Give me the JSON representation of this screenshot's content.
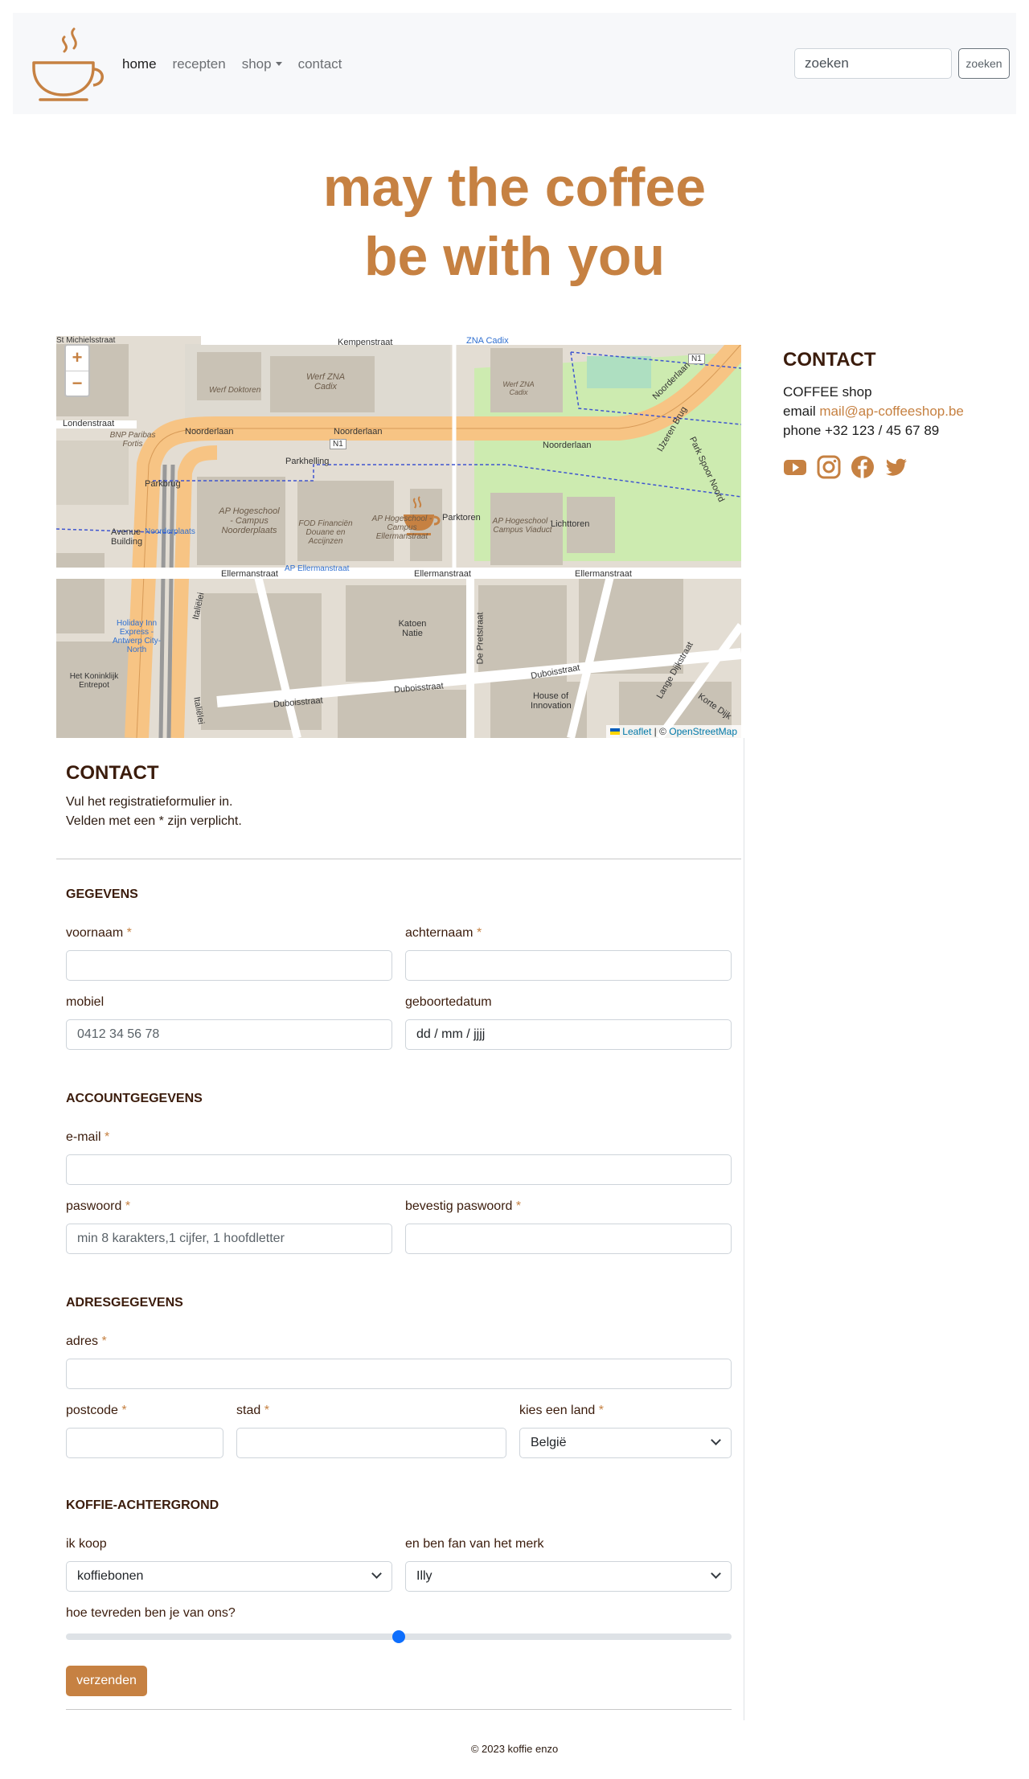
{
  "nav": {
    "links": [
      {
        "label": "home",
        "active": true
      },
      {
        "label": "recepten",
        "active": false
      },
      {
        "label": "shop",
        "active": false,
        "dropdown": true
      },
      {
        "label": "contact",
        "active": false
      }
    ],
    "search_placeholder": "zoeken",
    "search_button": "zoeken"
  },
  "hero": {
    "line1": "may the coffee",
    "line2": "be with you"
  },
  "map": {
    "zoom_in": "+",
    "zoom_out": "−",
    "attribution_leaflet": "Leaflet",
    "attribution_sep": " | © ",
    "attribution_osm": "OpenStreetMap",
    "labels": {
      "kempenstraat": "Kempenstraat",
      "zna_cadix": "ZNA Cadix",
      "werf_zna": "Werf ZNA Cadix",
      "werf_zna_small": "Werf ZNA Cadix",
      "werf_doktoren": "Werf Doktoren",
      "londenstraat": "Londenstraat",
      "noorderlaan_1": "Noorderlaan",
      "noorderlaan_2": "Noorderlaan",
      "noorderlaan_3": "Noorderlaan",
      "noorderlaan_4": "Noorderlaan",
      "parkhelling": "Parkhelling",
      "parkbrug": "Parkbrug",
      "bnp": "BNP Paribas Fortis",
      "ap_noorderplaats": "AP Hogeschool - Campus Noorderplaats",
      "fod": "FOD Financiën Douane en Accijnzen",
      "ap_ellermanstraat": "AP Hogeschool - Campus Ellermanstraat",
      "parktoren": "Parktoren",
      "ap_viaduct": "AP Hogeschool - Campus Viaduct",
      "lichttoren": "Lichttoren",
      "avenue": "Avenue Building",
      "noorderplaats_stop": "Noorderplaats",
      "ap_ellermanstraat_stop": "AP Ellermanstraat",
      "ellermanstraat_1": "Ellermanstraat",
      "ellermanstraat_2": "Ellermanstraat",
      "ellermanstraat_3": "Ellermanstraat",
      "katoen": "Katoen Natie",
      "holiday": "Holiday Inn Express - Antwerp City-North",
      "koninklijk": "Het Koninklijk Entrepot",
      "duboisstraat_1": "Duboisstraat",
      "duboisstraat_2": "Duboisstraat",
      "duboisstraat_3": "Duboisstraat",
      "house": "House of Innovation",
      "de_pretstraat": "De Pretstraat",
      "italielei_1": "Italiëlei",
      "italielei_2": "Italiëlei",
      "lange_dijkstraat": "Lange Dijkstraat",
      "n1": "N1",
      "n1b": "N1",
      "st_michielsstraat": "St Michielsstraat",
      "ijzeren_brug": "IJzeren Brug",
      "park_spoor_noord": "Park Spoor Noord",
      "korte_dijkstraat": "Korte Dijk"
    }
  },
  "sidebar": {
    "title": "CONTACT",
    "line1": "COFFEE shop",
    "email_label": "email ",
    "email": "mail@ap-coffeeshop.be",
    "phone": "phone +32 123 / 45 67 89",
    "socials": [
      "youtube-icon",
      "instagram-icon",
      "facebook-icon",
      "twitter-icon"
    ],
    "accent": "#c68142"
  },
  "form": {
    "title": "CONTACT",
    "intro1": "Vul het registratieformulier in.",
    "intro2": "Velden met een * zijn verplicht.",
    "sections": {
      "gegevens": "GEGEVENS",
      "account": "ACCOUNTGEGEVENS",
      "adres": "ADRESGEGEVENS",
      "koffie": "KOFFIE-ACHTERGROND"
    },
    "fields": {
      "voornaam": {
        "label": "voornaam",
        "required": "*",
        "value": ""
      },
      "achternaam": {
        "label": "achternaam",
        "required": "*",
        "value": ""
      },
      "mobiel": {
        "label": "mobiel",
        "placeholder": "0412 34 56 78"
      },
      "geboortedatum": {
        "label": "geboortedatum",
        "value": "dd / mm / jjjj"
      },
      "email": {
        "label": "e-mail",
        "required": "*",
        "value": ""
      },
      "paswoord": {
        "label": "paswoord",
        "required": "*",
        "placeholder": "min 8 karakters,1 cijfer, 1 hoofdletter"
      },
      "bevestig": {
        "label": "bevestig paswoord",
        "required": "*",
        "value": ""
      },
      "adres": {
        "label": "adres",
        "required": "*",
        "value": ""
      },
      "postcode": {
        "label": "postcode",
        "required": "*",
        "value": ""
      },
      "stad": {
        "label": "stad",
        "required": "*",
        "value": ""
      },
      "land": {
        "label": "kies een land",
        "required": "*",
        "selected": "België"
      },
      "koop": {
        "label": "ik koop",
        "selected": "koffiebonen"
      },
      "merk": {
        "label": "en ben fan van het merk",
        "selected": "Illy"
      },
      "tevreden": {
        "label": "hoe tevreden ben je van ons?",
        "value_percent": 50
      }
    },
    "submit": "verzenden"
  },
  "footer": "© 2023 koffie enzo"
}
